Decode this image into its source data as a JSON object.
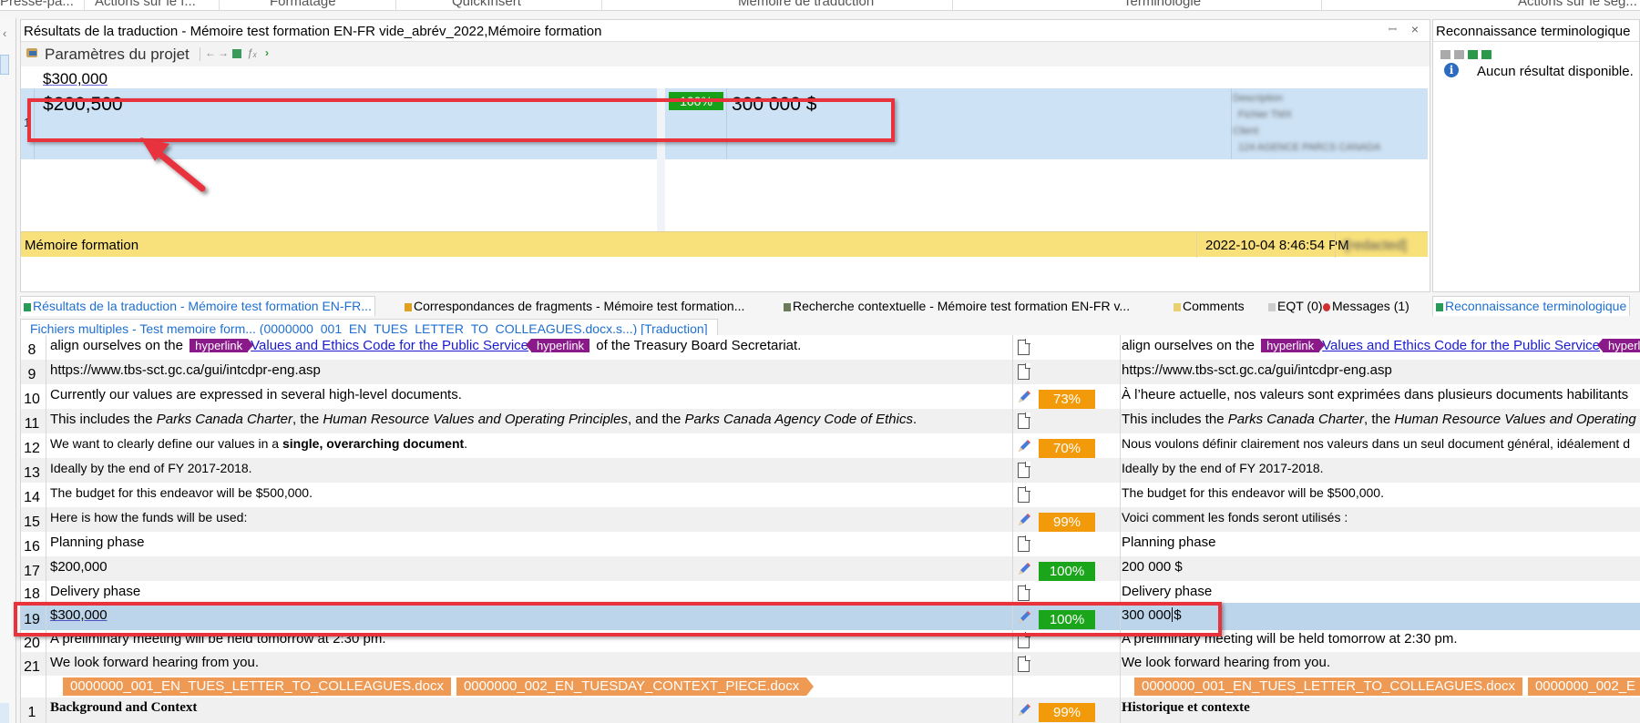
{
  "ribbon": {
    "groups": [
      "Presse-pa...",
      "Actions sur le f...",
      "Formatage",
      "QuickInsert",
      "Mémoire de traduction",
      "Terminologie",
      "Actions sur le seg..."
    ]
  },
  "translation_results": {
    "title": "Résultats de la traduction - Mémoire test formation EN-FR vide_abrév_2022,Mémoire formation",
    "toolbar": {
      "project_settings": "Paramètres du projet",
      "icons": [
        "arrow-left-icon",
        "arrow-right-icon",
        "tm-icon",
        "formula-icon",
        "chevron-right-icon"
      ]
    },
    "active_source": "$300,000",
    "match": {
      "number": "1",
      "source": "$200,500",
      "score": "100%",
      "target": "300 000 $",
      "meta_blurred": [
        "Description",
        "Fichier TMX",
        "Client",
        "124 AGENCE PARCS CANADA"
      ]
    },
    "status": {
      "memory_name": "Mémoire formation",
      "date": "2022-10-04 8:46:54 PM",
      "user": "I[redacted]"
    },
    "pin_icon": "pin-icon",
    "close_icon": "close-icon"
  },
  "term_recognition": {
    "title": "Reconnaissance terminologique",
    "no_results": "Aucun résultat disponible."
  },
  "bottom_tabs": [
    {
      "label": "Résultats de la traduction - Mémoire test formation EN-FR...",
      "active": true
    },
    {
      "label": "Correspondances de fragments - Mémoire test formation...",
      "active": false
    },
    {
      "label": "Recherche contextuelle - Mémoire test formation EN-FR v...",
      "active": false
    },
    {
      "label": "Comments",
      "active": false
    },
    {
      "label": "EQT (0)",
      "active": false
    },
    {
      "label": "Messages (1)",
      "active": false
    },
    {
      "label": "Reconnaissance terminologique",
      "active": true
    }
  ],
  "editor": {
    "document_tab": "Fichiers multiples - Test memoire form... (0000000_001_EN_TUES_LETTER_TO_COLLEAGUES.docx.s...) [Traduction]",
    "rows": [
      {
        "n": "8",
        "source_parts": [
          "align ourselves on the ",
          "hyperlink",
          "Values and Ethics Code for the Public Service",
          "hyperlink",
          " of the Treasury Board Secretariat."
        ],
        "status": "doc",
        "score": "",
        "target_parts": [
          "align ourselves on the ",
          "hyperlink",
          "Values and Ethics Code for the Public Service",
          "hyperlink",
          ""
        ]
      },
      {
        "n": "9",
        "source": "https://www.tbs-sct.gc.ca/gui/intcdpr-eng.asp",
        "status": "doc",
        "score": "",
        "target": "https://www.tbs-sct.gc.ca/gui/intcdpr-eng.asp"
      },
      {
        "n": "10",
        "source": "Currently our values are expressed in several high-level documents.",
        "status": "edited",
        "score": "73%",
        "score_color": "orange",
        "target": "À l’heure actuelle, nos valeurs sont exprimées dans plusieurs documents habilitants"
      },
      {
        "n": "11",
        "source_parts": [
          "This includes the ",
          "Parks Canada Charter",
          ", the ",
          "Human Resource Values and Operating Principles",
          ", and the ",
          "Parks Canada Agency Code of Ethics",
          "."
        ],
        "status": "doc",
        "score": "",
        "target_parts": [
          "This includes the ",
          "Parks Canada Charter",
          ", the ",
          "Human Resource Values and Operating Principles",
          ""
        ]
      },
      {
        "n": "12",
        "source_parts": [
          "We want to clearly define our values in a ",
          "single, overarching document",
          "."
        ],
        "status": "edited",
        "score": "70%",
        "score_color": "orange",
        "target": "Nous voulons définir clairement nos valeurs dans un seul document général, idéalement d"
      },
      {
        "n": "13",
        "source": "Ideally by the end of FY 2017-2018.",
        "status": "doc",
        "score": "",
        "target": "Ideally by the end of FY 2017-2018."
      },
      {
        "n": "14",
        "source": "The budget for this endeavor will be $500,000.",
        "status": "doc",
        "score": "",
        "target": "The budget for this endeavor will be $500,000."
      },
      {
        "n": "15",
        "source": "Here is how the funds will be used:",
        "status": "edited",
        "score": "99%",
        "score_color": "orange",
        "target": "Voici comment les fonds seront utilisés :"
      },
      {
        "n": "16",
        "source": "Planning phase",
        "status": "doc",
        "score": "",
        "target": "Planning phase"
      },
      {
        "n": "17",
        "source": "$200,000",
        "status": "edited",
        "score": "100%",
        "score_color": "green",
        "target": "200 000 $"
      },
      {
        "n": "18",
        "source": "Delivery phase",
        "status": "doc",
        "score": "",
        "target": "Delivery phase"
      },
      {
        "n": "19",
        "source": "$300,000",
        "status": "edited",
        "score": "100%",
        "score_color": "green",
        "target_before_caret": "300 000",
        "target_after_caret": "$",
        "active": true
      },
      {
        "n": "20",
        "source": "A preliminary meeting will be held tomorrow at 2:30 pm.",
        "status": "doc",
        "score": "",
        "target": "A preliminary meeting will be held tomorrow at 2:30 pm."
      },
      {
        "n": "21",
        "source": "We look forward hearing from you.",
        "status": "doc",
        "score": "",
        "target": "We look forward hearing from you."
      },
      {
        "n": "",
        "file_tags": [
          "0000000_001_EN_TUES_LETTER_TO_COLLEAGUES.docx",
          "0000000_002_EN_TUESDAY_CONTEXT_PIECE.docx"
        ],
        "target_file_tags": [
          "0000000_001_EN_TUES_LETTER_TO_COLLEAGUES.docx",
          "0000000_002_E"
        ]
      },
      {
        "n": "1",
        "source": "Background and Context",
        "status": "edited",
        "score": "99%",
        "score_color": "orange",
        "target": "Historique et contexte"
      }
    ]
  },
  "colors": {
    "match_green": "#1aa51a",
    "match_orange": "#f29a0a",
    "active_row": "#bcd5ea",
    "status_bar": "#f8e07b",
    "tag_purple": "#8a1a8a",
    "file_tag": "#ee9a55",
    "annotation_red": "#e8323c"
  }
}
